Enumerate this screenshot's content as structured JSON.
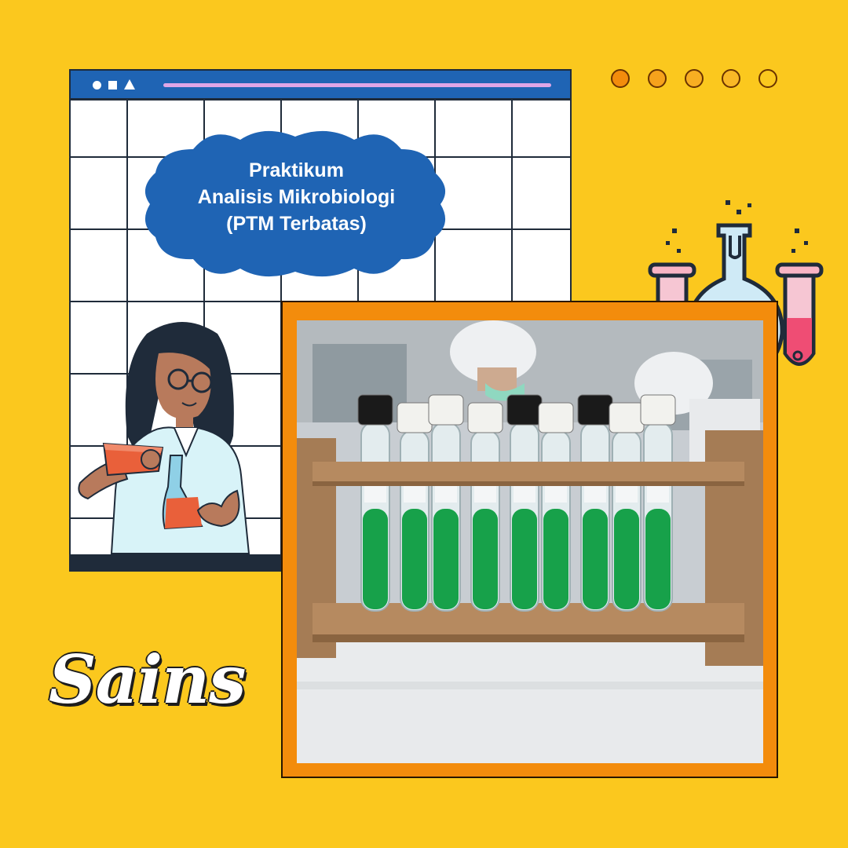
{
  "card": {
    "title_line1": "Praktikum",
    "title_line2": "Analisis Mikrobiologi",
    "title_line3": "(PTM Terbatas)",
    "subject": "Sains"
  },
  "colors": {
    "background": "#FBC81E",
    "window_bar": "#1f64b4",
    "cloud": "#1f64b4",
    "accent_orange": "#F38C0C",
    "medium_green": "#17a14a"
  },
  "decor": {
    "page_dots": 5,
    "icons": [
      "person-pouring-flask-illustration",
      "chemistry-flask-icon",
      "test-tube-icon"
    ]
  }
}
